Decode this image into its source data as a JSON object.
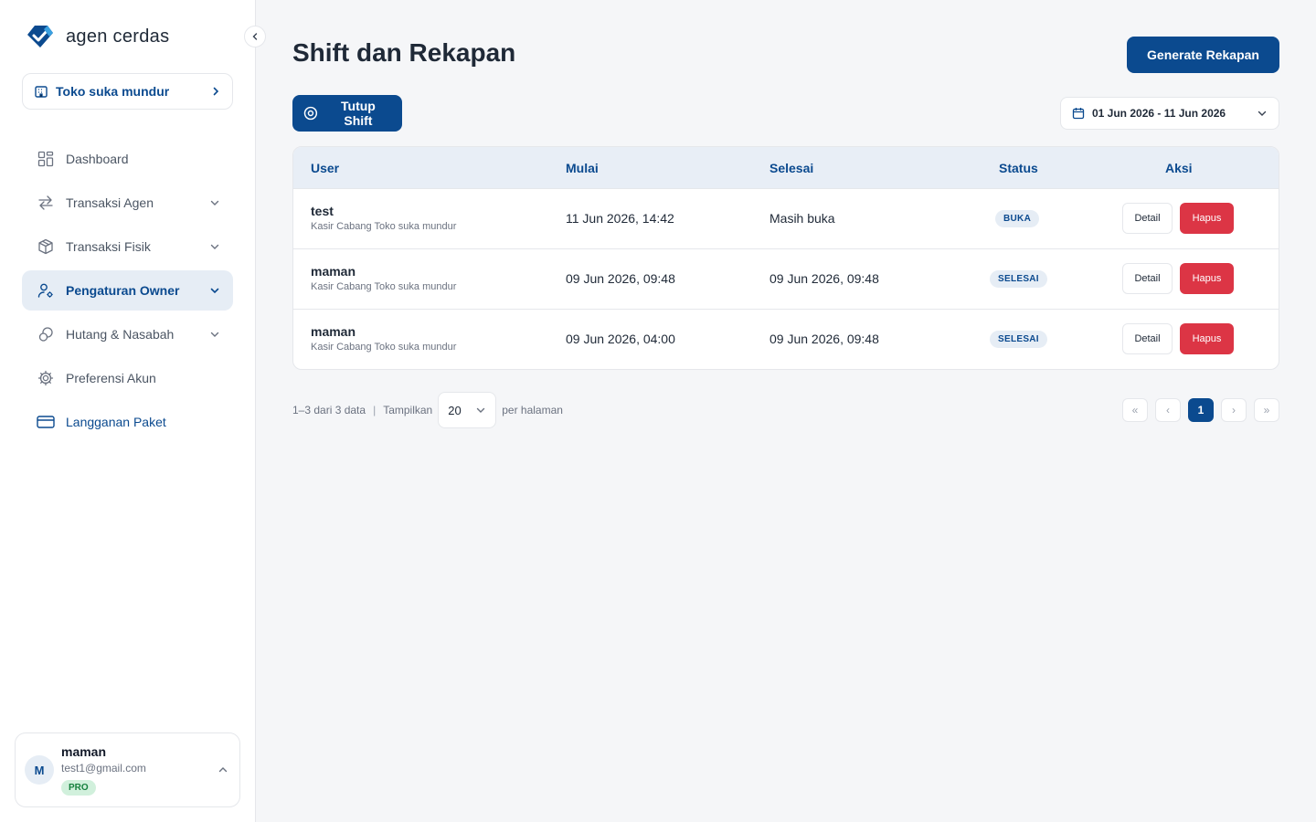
{
  "brand": {
    "name": "agen cerdas"
  },
  "store": {
    "name": "Toko suka mundur"
  },
  "nav": {
    "items": [
      {
        "label": "Dashboard"
      },
      {
        "label": "Transaksi Agen"
      },
      {
        "label": "Transaksi Fisik"
      },
      {
        "label": "Pengaturan Owner"
      },
      {
        "label": "Hutang & Nasabah"
      },
      {
        "label": "Preferensi Akun"
      },
      {
        "label": "Langganan Paket"
      }
    ]
  },
  "user": {
    "initial": "M",
    "name": "maman",
    "email": "test1@gmail.com",
    "plan": "PRO"
  },
  "page": {
    "title": "Shift dan Rekapan",
    "generate_label": "Generate Rekapan",
    "close_shift_label": "Tutup Shift",
    "date_range": "01 Jun 2026 - 11 Jun 2026"
  },
  "table": {
    "headers": {
      "user": "User",
      "start": "Mulai",
      "end": "Selesai",
      "status": "Status",
      "actions": "Aksi"
    },
    "detail_label": "Detail",
    "delete_label": "Hapus",
    "rows": [
      {
        "name": "test",
        "branch": "Kasir Cabang Toko suka mundur",
        "start": "11 Jun 2026, 14:42",
        "end": "Masih buka",
        "status": "BUKA"
      },
      {
        "name": "maman",
        "branch": "Kasir Cabang Toko suka mundur",
        "start": "09 Jun 2026, 09:48",
        "end": "09 Jun 2026, 09:48",
        "status": "SELESAI"
      },
      {
        "name": "maman",
        "branch": "Kasir Cabang Toko suka mundur",
        "start": "09 Jun 2026, 04:00",
        "end": "09 Jun 2026, 09:48",
        "status": "SELESAI"
      }
    ]
  },
  "pager": {
    "summary": "1–3 dari 3 data",
    "show_label": "Tampilkan",
    "page_size": "20",
    "per_page_label": "per halaman",
    "first": "«",
    "prev": "‹",
    "current": "1",
    "next": "›",
    "last": "»"
  },
  "colors": {
    "primary": "#0b4a8f",
    "danger": "#dc3545",
    "active_bg": "#e6edf5"
  }
}
